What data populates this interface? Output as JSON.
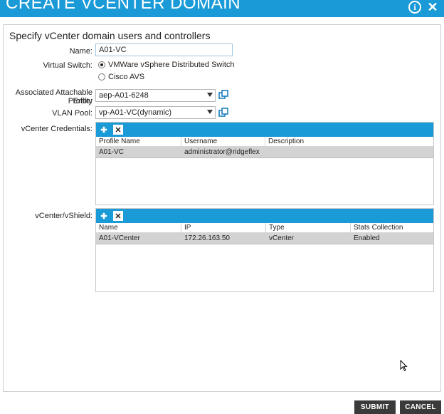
{
  "window": {
    "title": "CREATE VCENTER DOMAIN"
  },
  "form": {
    "heading": "Specify vCenter domain users and controllers",
    "name_label": "Name:",
    "name_value": "A01-VC",
    "vswitch_label": "Virtual Switch:",
    "vswitch_options": [
      "VMWare vSphere Distributed Switch",
      "Cisco AVS"
    ],
    "aep_label_line1": "Associated Attachable Entity",
    "aep_label_line2": "Profile:",
    "aep_value": "aep-A01-6248",
    "vlan_label": "VLAN Pool:",
    "vlan_value": "vp-A01-VC(dynamic)",
    "cred_label": "vCenter Credentials:",
    "vshield_label": "vCenter/vShield:"
  },
  "credentials": {
    "columns": [
      "Profile Name",
      "Username",
      "Description"
    ],
    "rows": [
      [
        "A01-VC",
        "administrator@ridgeflex",
        ""
      ]
    ]
  },
  "vcenters": {
    "columns": [
      "Name",
      "IP",
      "Type",
      "Stats Collection"
    ],
    "rows": [
      [
        "A01-VCenter",
        "172.26.163.50",
        "vCenter",
        "Enabled"
      ]
    ]
  },
  "footer": {
    "submit": "SUBMIT",
    "cancel": "CANCEL"
  },
  "colors": {
    "accent": "#1a9ad6",
    "row_selected": "#d3d3d3",
    "button_dark": "#3a3a3a"
  }
}
